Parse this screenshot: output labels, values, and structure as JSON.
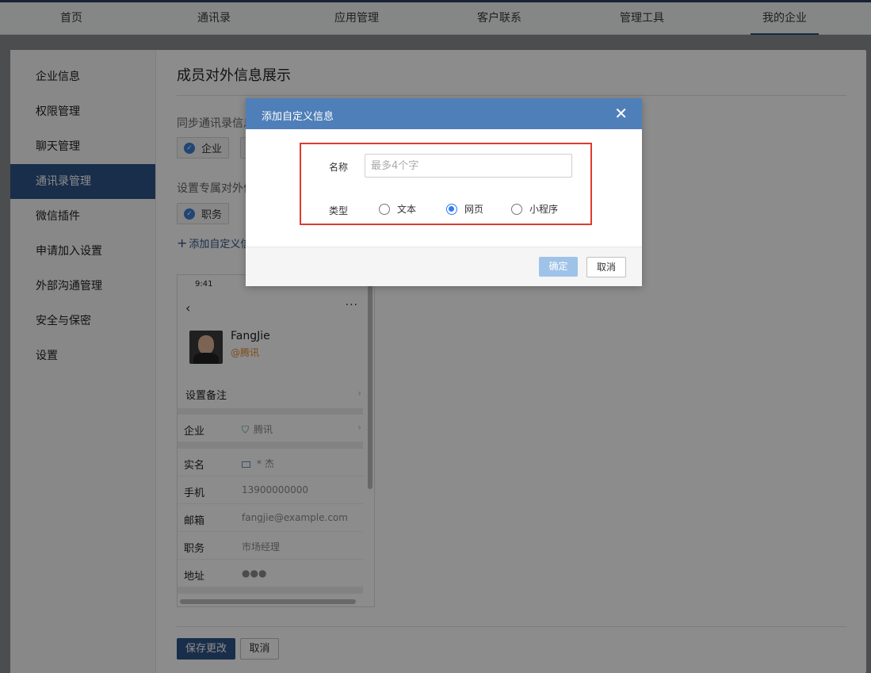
{
  "nav": [
    "首页",
    "通讯录",
    "应用管理",
    "客户联系",
    "管理工具",
    "我的企业"
  ],
  "sidebar": [
    "企业信息",
    "权限管理",
    "聊天管理",
    "通讯录管理",
    "微信插件",
    "申请加入设置",
    "外部沟通管理",
    "安全与保密",
    "设置"
  ],
  "content": {
    "title": "成员对外信息展示",
    "sync_label": "同步通讯录信息",
    "sync_chip": "企业",
    "custom_label": "设置专属对外信",
    "custom_chip": "职务",
    "add_link": "添加自定义信",
    "save": "保存更改",
    "cancel": "取消"
  },
  "phone": {
    "time": "9:41",
    "name": "FangJie",
    "corp": "@腾讯",
    "remark": "设置备注",
    "rows": [
      {
        "k": "企业",
        "v": "腾讯"
      },
      {
        "k": "实名",
        "v": "* 杰"
      },
      {
        "k": "手机",
        "v": "13900000000"
      },
      {
        "k": "邮箱",
        "v": "fangjie@example.com"
      },
      {
        "k": "职务",
        "v": "市场经理"
      },
      {
        "k": "地址",
        "v": "●●●"
      }
    ]
  },
  "modal": {
    "title": "添加自定义信息",
    "name_label": "名称",
    "name_placeholder": "最多4个字",
    "type_label": "类型",
    "options": [
      "文本",
      "网页",
      "小程序"
    ],
    "selected": "网页",
    "ok": "确定",
    "cancel": "取消"
  }
}
